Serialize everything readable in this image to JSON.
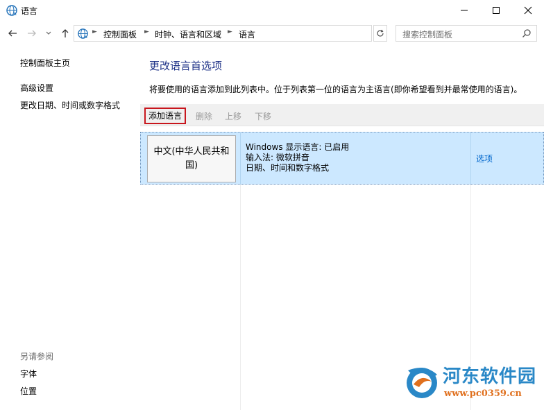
{
  "window": {
    "title": "语言",
    "icon": "language-globe-icon",
    "controls": [
      "minimize-icon",
      "maximize-icon",
      "close-icon"
    ]
  },
  "nav": {
    "back_icon": "arrow-left-icon",
    "forward_icon": "arrow-right-icon",
    "recent_icon": "chevron-down-icon",
    "up_icon": "arrow-up-icon",
    "breadcrumb": [
      "控制面板",
      "时钟、语言和区域",
      "语言"
    ],
    "refresh_icon": "refresh-icon",
    "search_placeholder": "搜索控制面板"
  },
  "sidebar": {
    "home": "控制面板主页",
    "items": [
      "高级设置",
      "更改日期、时间或数字格式"
    ],
    "see_also_label": "另请参阅",
    "see_also": [
      "字体",
      "位置"
    ]
  },
  "main": {
    "heading": "更改语言首选项",
    "description": "将要使用的语言添加到此列表中。位于列表第一位的语言为主语言(即你希望看到并最常使用的语言)。",
    "toolbar": {
      "add": "添加语言",
      "remove": "删除",
      "up": "上移",
      "down": "下移"
    },
    "languages": [
      {
        "name": "中文(中华人民共和国)",
        "info": [
          "Windows 显示语言: 已启用",
          "输入法: 微软拼音",
          "日期、时间和数字格式"
        ],
        "options": "选项"
      }
    ]
  },
  "watermark": {
    "title": "河东软件园",
    "url": "www.pc0359.cn"
  },
  "colors": {
    "heading": "#1e3287",
    "selection": "#cce8ff",
    "link": "#0066cc",
    "highlight_border": "#c8161d",
    "watermark_title": "#2a88c7",
    "watermark_url": "#e0701e"
  }
}
